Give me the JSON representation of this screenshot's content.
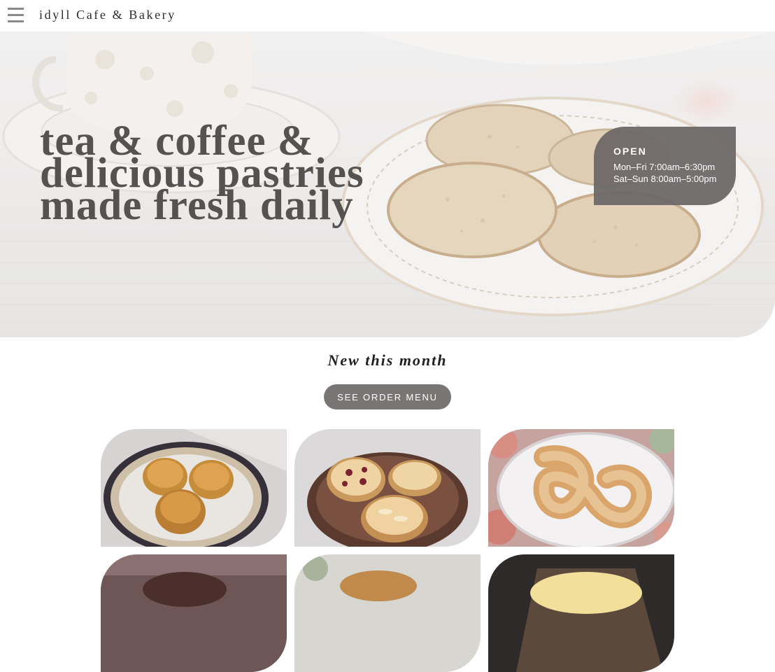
{
  "header": {
    "menu_icon": "hamburger-menu-icon",
    "brand": "idyll Cafe & Bakery"
  },
  "hero": {
    "headline": [
      "tea & coffee &",
      "delicious pastries",
      "made fresh daily"
    ],
    "hours": {
      "title": "OPEN",
      "lines": [
        "Mon–Fri 7:00am–6:30pm",
        "Sat–Sun 8:00am–5:00pm"
      ]
    }
  },
  "section": {
    "title": "New this month",
    "button_label": "SEE ORDER MENU"
  },
  "gallery": {
    "items": [
      "pastry-photo-apple-rose-tarts",
      "pastry-photo-berry-almond-tarts",
      "pastry-photo-sugar-pretzel-donut",
      "pastry-photo-chocolate-cake",
      "pastry-photo-croissant",
      "pastry-photo-egg-tart"
    ]
  },
  "colors": {
    "headline": "#555252",
    "hours_panel": "#6c6767",
    "button": "#7a7575",
    "brand_text": "#2a2a2a"
  }
}
